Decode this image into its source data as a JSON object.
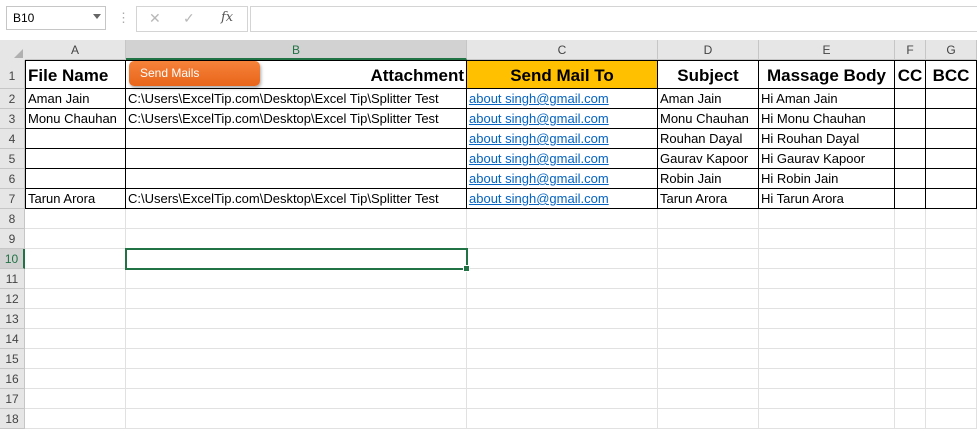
{
  "formula_bar": {
    "name_box": "B10",
    "separator": "⋮",
    "cancel_icon": "✕",
    "enter_icon": "✓",
    "fx_label": "fx",
    "formula": ""
  },
  "columns": [
    "A",
    "B",
    "C",
    "D",
    "E",
    "F",
    "G"
  ],
  "rows": [
    "1",
    "2",
    "3",
    "4",
    "5",
    "6",
    "7",
    "8",
    "9",
    "10",
    "11",
    "12",
    "13",
    "14",
    "15",
    "16",
    "17",
    "18"
  ],
  "header_row": {
    "file_name": "File Name",
    "attachment": "Attachment",
    "send_mail_to": "Send Mail To",
    "subject": "Subject",
    "message_body": "Massage Body",
    "cc": "CC",
    "bcc": "BCC"
  },
  "data_rows": [
    {
      "file_name": "Aman Jain",
      "attachment": "C:\\Users\\ExcelTip.com\\Desktop\\Excel Tip\\Splitter Test",
      "email": "about        singh@gmail.com",
      "subject": "Aman Jain",
      "body": "Hi Aman Jain"
    },
    {
      "file_name": "Monu Chauhan",
      "attachment": "C:\\Users\\ExcelTip.com\\Desktop\\Excel Tip\\Splitter Test",
      "email": "about        singh@gmail.com",
      "subject": "Monu Chauhan",
      "body": "Hi Monu Chauhan"
    },
    {
      "file_name": "",
      "attachment": "",
      "email": "about        singh@gmail.com",
      "subject": "Rouhan Dayal",
      "body": "Hi Rouhan Dayal"
    },
    {
      "file_name": "",
      "attachment": "",
      "email": "about        singh@gmail.com",
      "subject": "Gaurav Kapoor",
      "body": "Hi Gaurav Kapoor"
    },
    {
      "file_name": "",
      "attachment": "",
      "email": "about        singh@gmail.com",
      "subject": "Robin Jain",
      "body": "Hi Robin Jain"
    },
    {
      "file_name": "Tarun Arora",
      "attachment": "C:\\Users\\ExcelTip.com\\Desktop\\Excel Tip\\Splitter Test",
      "email": "about        singh@gmail.com",
      "subject": "Tarun Arora",
      "body": "Hi Tarun Arora"
    }
  ],
  "send_button": "Send Mails",
  "colors": {
    "accent": "#217346",
    "header_yellow": "#ffc000",
    "button_orange": "#f0742a",
    "link": "#0563c1"
  }
}
